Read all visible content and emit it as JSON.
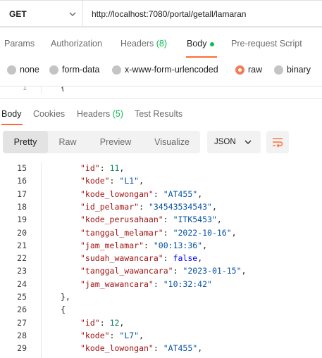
{
  "request": {
    "method": "GET",
    "url": "http://localhost:7080/portal/getall/lamaran"
  },
  "request_tabs": [
    {
      "label": "Params",
      "count": ""
    },
    {
      "label": "Authorization",
      "count": ""
    },
    {
      "label": "Headers",
      "count": "(8)"
    },
    {
      "label": "Body",
      "count": ""
    },
    {
      "label": "Pre-request Script",
      "count": ""
    }
  ],
  "active_request_tab": "Body",
  "body_types": [
    "none",
    "form-data",
    "x-www-form-urlencoded",
    "raw",
    "binary"
  ],
  "selected_body_type": "raw",
  "editor_strip": {
    "line": "1",
    "text": "{"
  },
  "response_tabs": [
    {
      "label": "Body",
      "count": ""
    },
    {
      "label": "Cookies",
      "count": ""
    },
    {
      "label": "Headers",
      "count": "(5)"
    },
    {
      "label": "Test Results",
      "count": ""
    }
  ],
  "active_response_tab": "Body",
  "view_modes": [
    "Pretty",
    "Raw",
    "Preview",
    "Visualize"
  ],
  "active_view_mode": "Pretty",
  "format": "JSON",
  "icons": {
    "method_dropdown": "chevron-down-icon",
    "format_dropdown": "chevron-down-icon",
    "wrap": "wrap-lines-icon",
    "active_dot": "status-dot-icon"
  },
  "colors": {
    "accent": "#ff6c37",
    "count_green": "#0cbb52",
    "key": "#a31515",
    "string": "#0451a5",
    "number": "#098658",
    "boolean": "#0000ff"
  },
  "code_lines": [
    {
      "n": "15",
      "indent": true,
      "key": "id",
      "value": "11",
      "vtype": "num",
      "comma": true
    },
    {
      "n": "16",
      "indent": true,
      "key": "kode",
      "value": "L1",
      "vtype": "str",
      "comma": true
    },
    {
      "n": "17",
      "indent": true,
      "key": "kode_lowongan",
      "value": "AT455",
      "vtype": "str",
      "comma": true
    },
    {
      "n": "18",
      "indent": true,
      "key": "id_pelamar",
      "value": "34543534543",
      "vtype": "str",
      "comma": true
    },
    {
      "n": "19",
      "indent": true,
      "key": "kode_perusahaan",
      "value": "ITK5453",
      "vtype": "str",
      "comma": true
    },
    {
      "n": "20",
      "indent": true,
      "key": "tanggal_melamar",
      "value": "2022-10-16",
      "vtype": "str",
      "comma": true
    },
    {
      "n": "21",
      "indent": true,
      "key": "jam_melamar",
      "value": "00:13:36",
      "vtype": "str",
      "comma": true
    },
    {
      "n": "22",
      "indent": true,
      "key": "sudah_wawancara",
      "value": "false",
      "vtype": "bool",
      "comma": true
    },
    {
      "n": "23",
      "indent": true,
      "key": "tanggal_wawancara",
      "value": "2023-01-15",
      "vtype": "str",
      "comma": true
    },
    {
      "n": "24",
      "indent": true,
      "key": "jam_wawancara",
      "value": "10:32:42",
      "vtype": "str",
      "comma": false
    },
    {
      "n": "25",
      "indent": false,
      "punct": "},"
    },
    {
      "n": "26",
      "indent": false,
      "punct": "{"
    },
    {
      "n": "27",
      "indent": true,
      "key": "id",
      "value": "12",
      "vtype": "num",
      "comma": true
    },
    {
      "n": "28",
      "indent": true,
      "key": "kode",
      "value": "L7",
      "vtype": "str",
      "comma": true
    },
    {
      "n": "29",
      "indent": true,
      "key": "kode_lowongan",
      "value": "AT455",
      "vtype": "str",
      "comma": true
    }
  ]
}
